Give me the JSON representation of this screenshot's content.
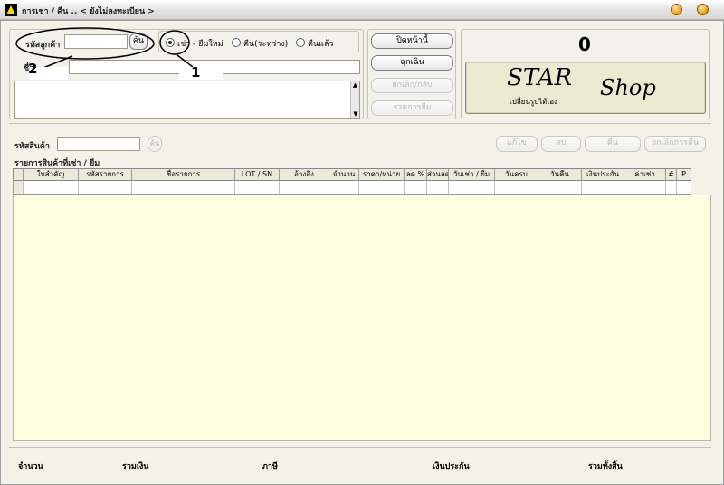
{
  "window": {
    "title": "การเช่า / คืน .. < ยังไม่ลงทะเบียน >"
  },
  "customer": {
    "code_label": "รหัสลูกค้า",
    "code_value": "",
    "find_button": "ค้น",
    "name_label": "ชื่อ",
    "name_value": "",
    "address_value": ""
  },
  "mode": {
    "options": [
      {
        "label": "เช่า - ยืมใหม่",
        "selected": true
      },
      {
        "label": "คืน(ระหว่าง)",
        "selected": false
      },
      {
        "label": "คืนแล้ว",
        "selected": false
      }
    ]
  },
  "actions": {
    "close_bill": "ปิดหน้านี้",
    "save": "ฉุกเฉิน",
    "cancel_return": "ยกเลิก/กลับ",
    "merge": "รวมการยืม"
  },
  "counter": {
    "value": "0"
  },
  "logo": {
    "line1": "STAR",
    "line2": "Shop",
    "tagline": "เปลี่ยนรูปได้เอง"
  },
  "item": {
    "code_label": "รหัสสินค้า",
    "code_value": "",
    "find_button": "ค้น",
    "edit_button": "แก้ไข",
    "delete_button": "ลบ",
    "return_button": "คืน",
    "cancel_return_button": "ยกเลิกการคืน"
  },
  "grid": {
    "caption": "รายการสินค้าที่เช่า / ยืม",
    "columns": [
      "ใบสำคัญ",
      "รหัสรายการ",
      "ชื่อรายการ",
      "LOT / SN",
      "อ้างอิง",
      "จำนวน",
      "ราคา/หน่วย",
      "ลด %",
      "ส่วนลด",
      "วันเช่า / ยืม",
      "วันครบ",
      "วันคืน",
      "เงินประกัน",
      "ค่าเช่า",
      "#",
      "P"
    ]
  },
  "footer": {
    "qty": "จำนวน",
    "sum_total": "รวมเงิน",
    "tax": "ภาษี",
    "deposit": "เงินประกัน",
    "grand_total": "รวมทั้งสิ้น"
  },
  "annotations": {
    "one": "1",
    "two": "2"
  },
  "colors": {
    "grid_body": "#FFFFE0",
    "window_bg": "#F4F2E8",
    "accent": "#F0A020"
  }
}
